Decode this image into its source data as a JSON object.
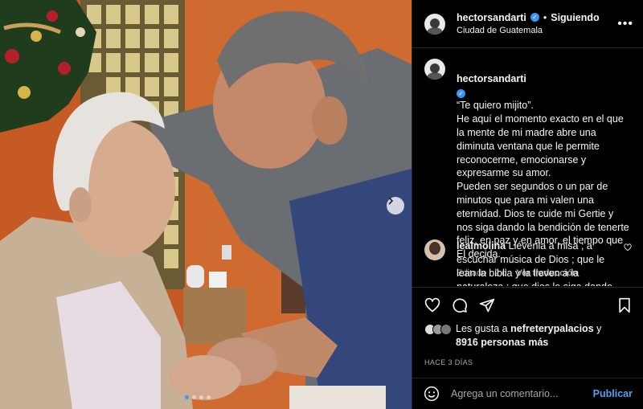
{
  "post": {
    "username": "hectorsandarti",
    "separator": "•",
    "follow_label": "Siguiendo",
    "location": "Ciudad de Guatemala",
    "more_label": "•••",
    "caption": "“Te quiero mijito”.\nHe aquí el momento exacto en el que la mente de mi madre abre una diminuta ventana que le permite reconocerme, emocionarse y expresarme su amor.\nPueden ser segundos o un par de minutos que para mi valen una eternidad. Dios te cuide mi Gertie y nos siga dando la bendición de tenerte feliz, en paz y en amor, el tiempo que El decida.",
    "edited_label": "Editado · 2 d",
    "translate_label": "Ver traducción"
  },
  "comment": {
    "username": "lealmolina",
    "text": "Llévenla a misa ; a escuchar música de Dios ; que le lean la biblia y la lleven a la naturaleza ; que dios le siga dando"
  },
  "likes": {
    "prefix": "Les gusta a",
    "user": "nefreterypalacios",
    "connector": "y",
    "others": "8916 personas más"
  },
  "timestamp": "HACE 3 DÍAS",
  "add_comment": {
    "placeholder": "Agrega un comentario...",
    "post_label": "Publicar"
  },
  "carousel": {
    "slide_count": 4,
    "active_index": 0
  },
  "icons": {
    "like": "heart-icon",
    "comment": "comment-bubble-icon",
    "share": "paper-plane-icon",
    "save": "bookmark-icon",
    "emoji": "smiley-icon",
    "next": "chevron-right-icon",
    "options": "ellipsis-icon"
  },
  "colors": {
    "background": "#000000",
    "text": "#f5f5f5",
    "muted": "#a8a8a8",
    "verified": "#3897f0",
    "post_button": "#4fa4ea",
    "divider": "#262626"
  }
}
